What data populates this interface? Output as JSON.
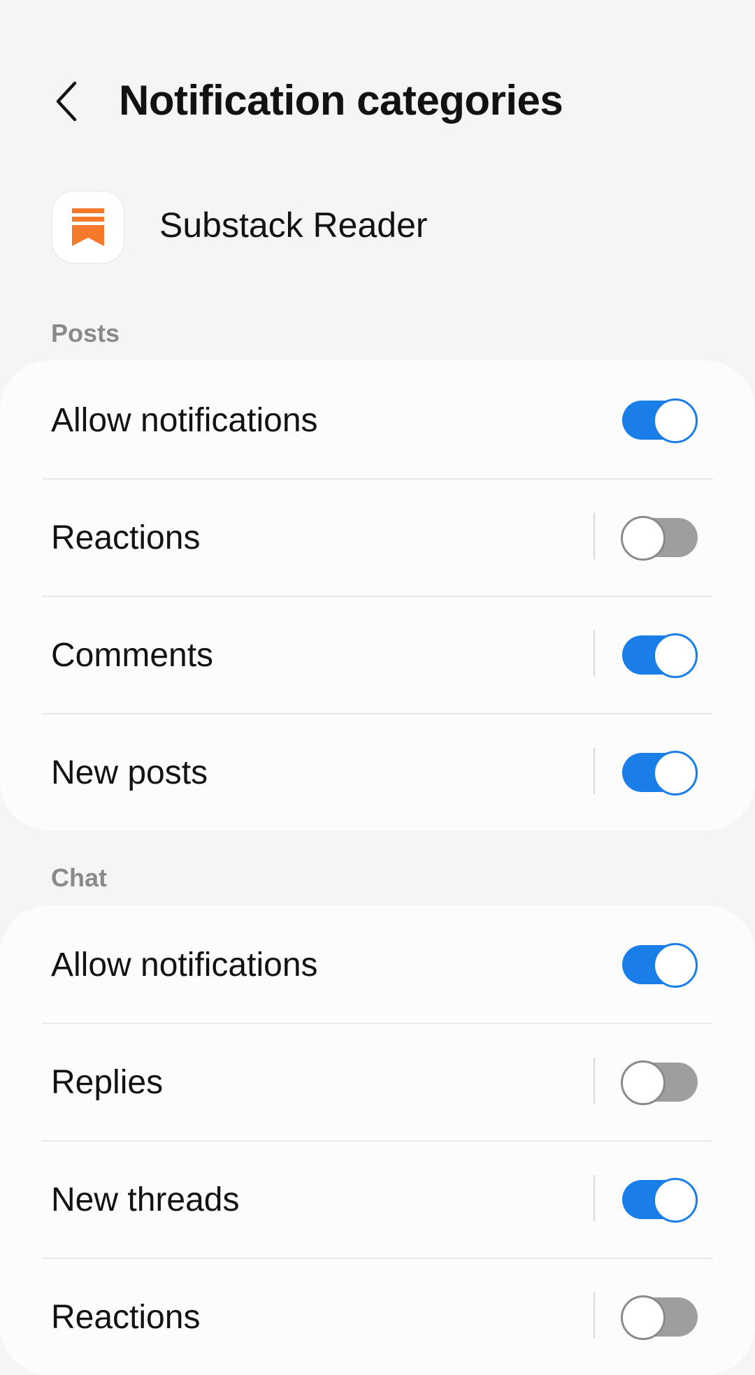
{
  "header": {
    "title": "Notification categories"
  },
  "app": {
    "name": "Substack Reader",
    "icon": "substack-bookmark-icon",
    "icon_color": "#f4792b"
  },
  "colors": {
    "accent": "#1a7ee8",
    "switch_off": "#9e9e9e",
    "background": "#f5f5f5",
    "card": "#fcfcfc"
  },
  "sections": [
    {
      "header": "Posts",
      "rows": [
        {
          "label": "Allow notifications",
          "on": true
        },
        {
          "label": "Reactions",
          "on": false
        },
        {
          "label": "Comments",
          "on": true
        },
        {
          "label": "New posts",
          "on": true
        }
      ]
    },
    {
      "header": "Chat",
      "rows": [
        {
          "label": "Allow notifications",
          "on": true
        },
        {
          "label": "Replies",
          "on": false
        },
        {
          "label": "New threads",
          "on": true
        },
        {
          "label": "Reactions",
          "on": false
        }
      ]
    }
  ]
}
